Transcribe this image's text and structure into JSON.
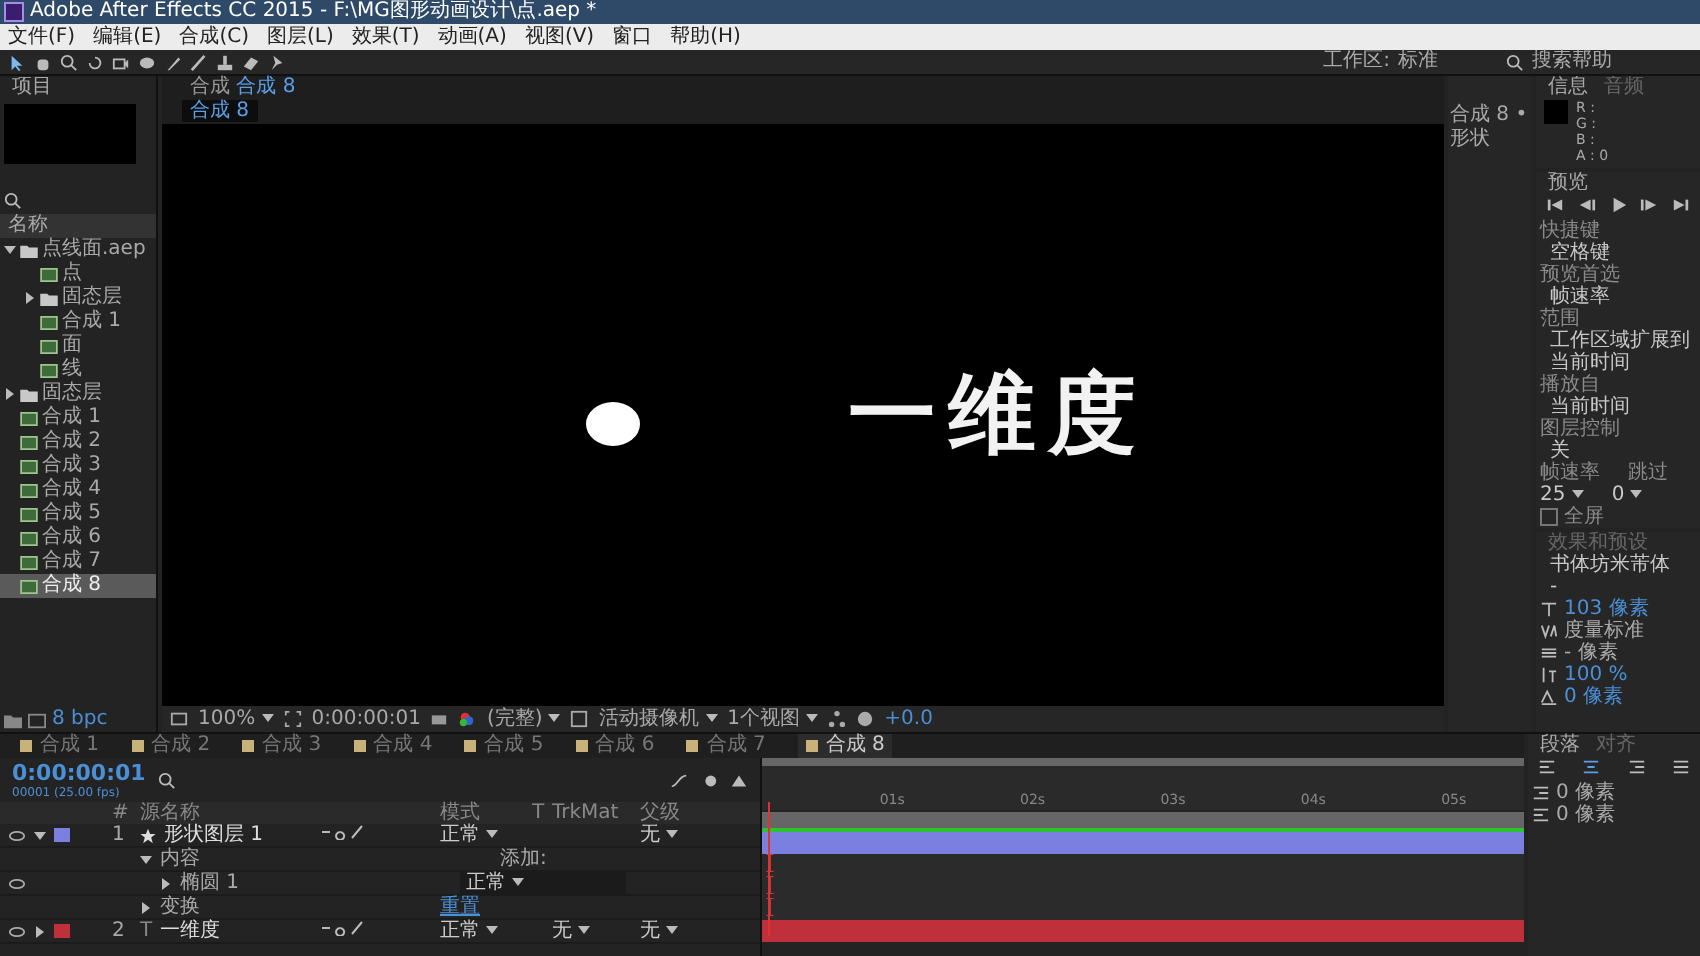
{
  "window": {
    "title": "Adobe After Effects CC 2015 - F:\\MG图形动画设计\\点.aep *"
  },
  "menu": [
    "文件(F)",
    "编辑(E)",
    "合成(C)",
    "图层(L)",
    "效果(T)",
    "动画(A)",
    "视图(V)",
    "窗口",
    "帮助(H)"
  ],
  "toolbar": {
    "workspace_label": "工作区:",
    "workspace": "标准",
    "search": "搜索帮助"
  },
  "project": {
    "title": "项目",
    "column": "名称",
    "bpc": "8 bpc",
    "items": [
      {
        "name": "点线面.aep",
        "kind": "folder",
        "expanded": true,
        "selected": false,
        "children": [
          {
            "name": "点",
            "kind": "comp",
            "selected": false
          },
          {
            "name": "固态层",
            "kind": "folder",
            "expanded": false,
            "selected": false
          },
          {
            "name": "合成 1",
            "kind": "comp",
            "selected": false
          },
          {
            "name": "面",
            "kind": "comp",
            "selected": false
          },
          {
            "name": "线",
            "kind": "comp",
            "selected": false
          }
        ]
      },
      {
        "name": "固态层",
        "kind": "folder",
        "expanded": false,
        "selected": false
      },
      {
        "name": "合成 1",
        "kind": "comp",
        "selected": false
      },
      {
        "name": "合成 2",
        "kind": "comp",
        "selected": false
      },
      {
        "name": "合成 3",
        "kind": "comp",
        "selected": false
      },
      {
        "name": "合成 4",
        "kind": "comp",
        "selected": false
      },
      {
        "name": "合成 5",
        "kind": "comp",
        "selected": false
      },
      {
        "name": "合成 6",
        "kind": "comp",
        "selected": false
      },
      {
        "name": "合成 7",
        "kind": "comp",
        "selected": false
      },
      {
        "name": "合成 8",
        "kind": "comp",
        "selected": true
      }
    ]
  },
  "viewer": {
    "tab_prefix": "合成",
    "tab": "合成 8",
    "breadcrumb": "合成 8",
    "text": "一维度",
    "zoom": "100%",
    "timecode": "0:00:00:01",
    "resolution": "(完整)",
    "camera": "活动摄像机",
    "views": "1个视图",
    "exposure": "+0.0"
  },
  "flowchart": {
    "label": "合成 8 • 形状"
  },
  "info": {
    "title": "信息",
    "tab2": "音频",
    "rows": [
      "R :",
      "G :",
      "B :",
      "A : 0"
    ]
  },
  "preview": {
    "title": "预览",
    "fields": [
      {
        "kind": "label",
        "text": "快捷键"
      },
      {
        "kind": "value",
        "text": "空格键"
      },
      {
        "kind": "label",
        "text": "预览首选"
      },
      {
        "kind": "value",
        "text": "帧速率"
      },
      {
        "kind": "label",
        "text": "范围"
      },
      {
        "kind": "value",
        "text": "工作区域扩展到当前时间"
      },
      {
        "kind": "label",
        "text": "播放自"
      },
      {
        "kind": "value",
        "text": "当前时间"
      },
      {
        "kind": "label",
        "text": "图层控制"
      },
      {
        "kind": "value",
        "text": "关"
      }
    ],
    "rate_label": "帧速率",
    "skip_label": "跳过",
    "rate": "25",
    "skip": "0",
    "fullscreen": "全屏",
    "fullscreen_checked": false
  },
  "effects": {
    "title": "效果和预设"
  },
  "character": {
    "font": "书体坊米芾体",
    "style": "-",
    "size": "103 像素",
    "kerning": "度量标准",
    "leading": "- 像素",
    "scale": "100 %",
    "baseline": "0 像素"
  },
  "timeline": {
    "tabs": [
      {
        "label": "合成 1",
        "selected": false
      },
      {
        "label": "合成 2",
        "selected": false
      },
      {
        "label": "合成 3",
        "selected": false
      },
      {
        "label": "合成 4",
        "selected": false
      },
      {
        "label": "合成 5",
        "selected": false
      },
      {
        "label": "合成 6",
        "selected": false
      },
      {
        "label": "合成 7",
        "selected": false
      },
      {
        "label": "合成 8",
        "selected": true
      }
    ],
    "timecode": "0:00:00:01",
    "fps": "00001 (25.00 fps)",
    "columns": {
      "index": "#",
      "name": "源名称",
      "mode": "模式",
      "t": "T",
      "trkmat": "TrkMat",
      "parent": "父级"
    },
    "rows": [
      {
        "kind": "layer",
        "index": "1",
        "name": "形状图层 1",
        "color": "#7b7fe0",
        "expanded": true,
        "mode": "正常",
        "parent": "无"
      },
      {
        "kind": "group",
        "name": "内容",
        "expanded": true,
        "action": "添加:"
      },
      {
        "kind": "property",
        "name": "椭圆 1",
        "expanded": false,
        "value": "正常"
      },
      {
        "kind": "group",
        "name": "变换",
        "expanded": false,
        "action": "重置"
      },
      {
        "kind": "layer",
        "index": "2",
        "glyph": "T",
        "name": "一维度",
        "color": "#c0303a",
        "expanded": false,
        "mode": "正常",
        "trkmat": "无",
        "parent": "无"
      }
    ],
    "ruler": [
      "01s",
      "02s",
      "03s",
      "04s",
      "05s"
    ]
  },
  "paragraph": {
    "title": "段落",
    "tab2": "对齐",
    "indent_left": "0 像素",
    "indent_right": "0 像素"
  }
}
